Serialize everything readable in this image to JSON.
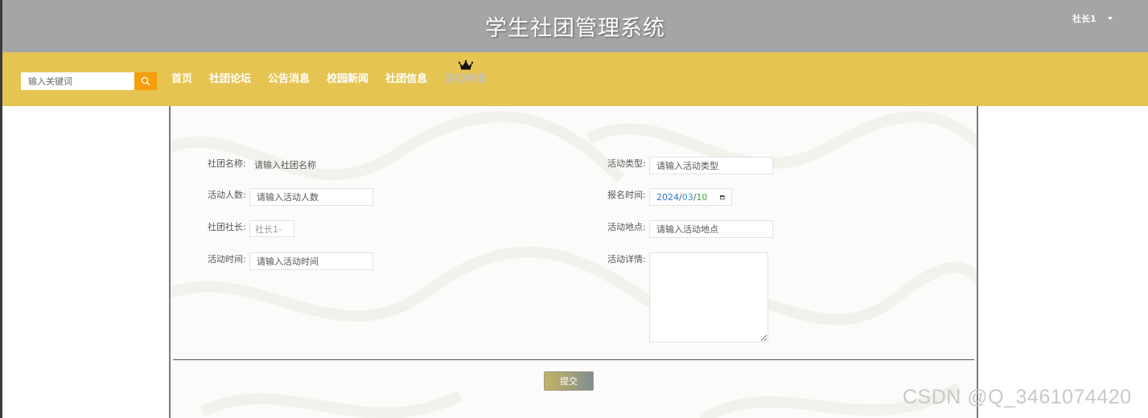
{
  "header": {
    "site_title": "学生社团管理系统",
    "user": "社长1"
  },
  "navbar": {
    "search_placeholder": "输入关键词",
    "items": [
      {
        "label": "首页"
      },
      {
        "label": "社团论坛"
      },
      {
        "label": "公告消息"
      },
      {
        "label": "校园新闻"
      },
      {
        "label": "社团信息"
      },
      {
        "label": "活动申请",
        "active": true
      }
    ]
  },
  "form": {
    "club_name": {
      "label": "社团名称:",
      "placeholder": "请输入社团名称"
    },
    "activity_type": {
      "label": "活动类型:",
      "placeholder": "请输入活动类型"
    },
    "participants": {
      "label": "活动人数:",
      "placeholder": "请输入活动人数"
    },
    "signup_time": {
      "label": "报名时间:",
      "year": "2024",
      "month": "03",
      "day": "10",
      "sep": "/"
    },
    "club_leader": {
      "label": "社团社长:",
      "value": "社长1-"
    },
    "location": {
      "label": "活动地点:",
      "placeholder": "请输入活动地点"
    },
    "activity_time": {
      "label": "活动时间:",
      "placeholder": "请输入活动时间"
    },
    "details": {
      "label": "活动详情:"
    },
    "submit_label": "提交"
  },
  "watermark": "CSDN @Q_3461074420",
  "colors": {
    "header_bg": "#a5a5a7",
    "navbar_bg": "#e6c451",
    "search_button": "#f59f0b"
  }
}
